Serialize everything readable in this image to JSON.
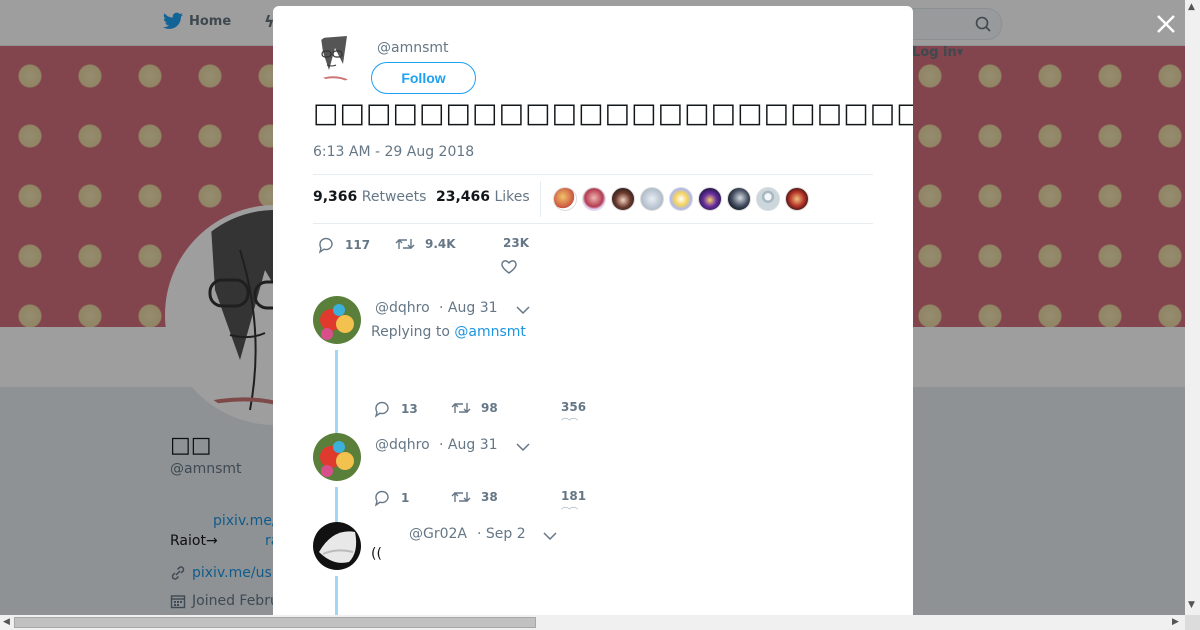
{
  "nav": {
    "home_label": "Home",
    "login_label": "Log in"
  },
  "profile": {
    "name": "□□",
    "handle": "@amnsmt",
    "bio_link1": "pixiv.me/",
    "bio_text": "Raiot→",
    "bio_link2": "ra",
    "url": "pixiv.me/us",
    "joined": "Joined Febru"
  },
  "tweet": {
    "author_handle": "@amnsmt",
    "follow_label": "Follow",
    "text": "□□□□□□□□□□□□□□□□□□□□□□□□□□□□□□□□□□□□□□□□□□□□□□□□□□□□□□□□□□□□□□□□□□",
    "time": "6:13 AM - 29 Aug 2018",
    "retweets_count": "9,366",
    "retweets_label": "Retweets",
    "likes_count": "23,466",
    "likes_label": "Likes",
    "reply_count": "117",
    "retweet_count_short": "9.4K",
    "like_count_short": "23K"
  },
  "replies": [
    {
      "handle": "@dqhro",
      "date": "· Aug 31",
      "replying_prefix": "Replying to",
      "replying_to": "@amnsmt",
      "replies": "13",
      "retweets": "98",
      "likes": "356"
    },
    {
      "handle": "@dqhro",
      "date": "· Aug 31",
      "replies": "1",
      "retweets": "38",
      "likes": "181"
    },
    {
      "handle": "@Gr02A",
      "date": "· Sep 2",
      "text": "(("
    }
  ],
  "colors": {
    "accent": "#1da1f2",
    "link": "#1b95e0",
    "muted": "#657786",
    "banner": "#d4707c",
    "thread": "#a3d6f5"
  }
}
